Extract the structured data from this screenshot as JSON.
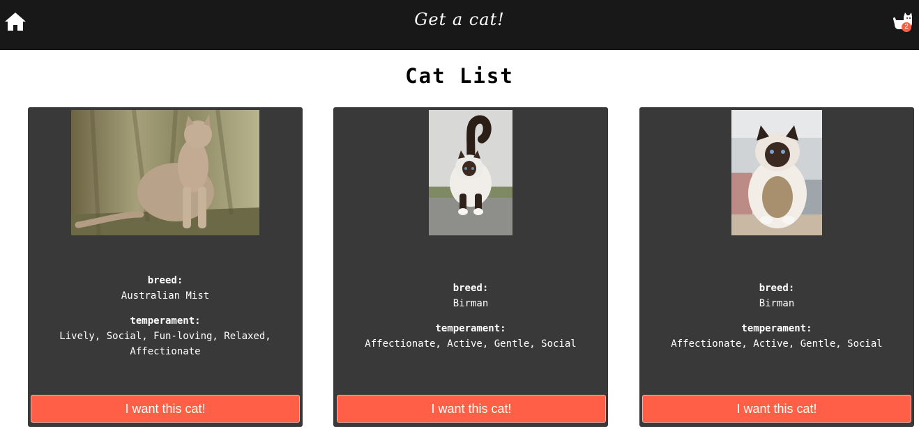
{
  "header": {
    "title": "Get a cat!",
    "home_icon": "home-icon",
    "cart_icon": "cat-cart-icon",
    "cart_count": "2"
  },
  "page": {
    "title": "Cat List"
  },
  "cards": [
    {
      "breed_label": "breed:",
      "breed": "Australian Mist",
      "temperament_label": "temperament:",
      "temperament": "Lively, Social, Fun-loving, Relaxed, Affectionate",
      "button": "I want this cat!"
    },
    {
      "breed_label": "breed:",
      "breed": "Birman",
      "temperament_label": "temperament:",
      "temperament": "Affectionate, Active, Gentle, Social",
      "button": "I want this cat!"
    },
    {
      "breed_label": "breed:",
      "breed": "Birman",
      "temperament_label": "temperament:",
      "temperament": "Affectionate, Active, Gentle, Social",
      "button": "I want this cat!"
    }
  ],
  "colors": {
    "header_bg": "#181818",
    "card_bg": "#393939",
    "accent": "#ff5f46"
  }
}
